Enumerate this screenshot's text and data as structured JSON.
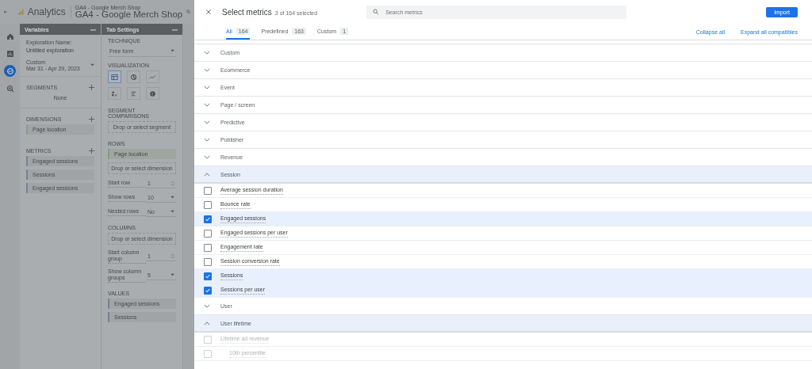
{
  "app": {
    "product": "Analytics",
    "property_caption": "GA4 - Google Merch Shop",
    "property": "GA4 - Google Merch Shop"
  },
  "rail": [
    {
      "kind": "home",
      "selected": false
    },
    {
      "kind": "reports",
      "selected": false
    },
    {
      "kind": "explore",
      "selected": true
    },
    {
      "kind": "advertising",
      "selected": false
    }
  ],
  "variables": {
    "title": "Variables",
    "exploration_label": "Exploration Name:",
    "exploration_name": "Untitled exploration",
    "date_label": "Custom",
    "date_range": "Mar 31 - Apr 29, 2023",
    "segments": {
      "title": "SEGMENTS",
      "empty": "None"
    },
    "dimensions": {
      "title": "DIMENSIONS",
      "items": [
        "Page location"
      ]
    },
    "metrics": {
      "title": "METRICS",
      "items": [
        "Engaged sessions",
        "Sessions",
        "Engaged sessions"
      ]
    }
  },
  "tab_settings": {
    "title": "Tab Settings",
    "technique": {
      "label": "TECHNIQUE",
      "value": "Free form"
    },
    "visualization": {
      "label": "VISUALIZATION",
      "options": [
        {
          "kind": "table",
          "selected": true
        },
        {
          "kind": "donut",
          "selected": false
        },
        {
          "kind": "line",
          "selected": false
        },
        {
          "kind": "scatter",
          "selected": false
        },
        {
          "kind": "bar",
          "selected": false
        },
        {
          "kind": "geo",
          "selected": false
        }
      ]
    },
    "segment_comparisons": {
      "label": "SEGMENT COMPARISONS",
      "placeholder": "Drop or select segment"
    },
    "rows": {
      "label": "ROWS",
      "items": [
        "Page location"
      ],
      "placeholder": "Drop or select dimension",
      "settings": [
        {
          "label": "Start row",
          "value": "1",
          "kind": "stepper"
        },
        {
          "label": "Show rows",
          "value": "10",
          "kind": "select"
        },
        {
          "label": "Nested rows",
          "value": "No",
          "kind": "select"
        }
      ]
    },
    "columns": {
      "label": "COLUMNS",
      "placeholder": "Drop or select dimension",
      "settings": [
        {
          "label": "Start column group",
          "value": "1",
          "kind": "stepper"
        },
        {
          "label": "Show column groups",
          "value": "5",
          "kind": "select"
        }
      ]
    },
    "values": {
      "label": "VALUES",
      "items": [
        "Engaged sessions",
        "Sessions"
      ]
    }
  },
  "dialog": {
    "title": "Select metrics",
    "count": "3 of 164 selected",
    "search": {
      "placeholder": "Search metrics"
    },
    "import": "Import",
    "tabs": [
      {
        "label": "All",
        "count": "164",
        "selected": true
      },
      {
        "label": "Predefined",
        "count": "163",
        "selected": false
      },
      {
        "label": "Custom",
        "count": "1",
        "selected": false
      }
    ],
    "actions": [
      "Collapse all",
      "Expand all compatibles"
    ],
    "groups": [
      {
        "name": "Custom",
        "expanded": false
      },
      {
        "name": "Ecommerce",
        "expanded": false
      },
      {
        "name": "Event",
        "expanded": false
      },
      {
        "name": "Page / screen",
        "expanded": false
      },
      {
        "name": "Predictive",
        "expanded": false
      },
      {
        "name": "Publisher",
        "expanded": false
      },
      {
        "name": "Revenue",
        "expanded": false
      },
      {
        "name": "Session",
        "expanded": true,
        "metrics": [
          {
            "name": "Average session duration",
            "checked": false,
            "disabled": false
          },
          {
            "name": "Bounce rate",
            "checked": false,
            "disabled": false
          },
          {
            "name": "Engaged sessions",
            "checked": true,
            "disabled": false
          },
          {
            "name": "Engaged sessions per user",
            "checked": false,
            "disabled": false
          },
          {
            "name": "Engagement rate",
            "checked": false,
            "disabled": false
          },
          {
            "name": "Session conversion rate",
            "checked": false,
            "disabled": false
          },
          {
            "name": "Sessions",
            "checked": true,
            "disabled": false
          },
          {
            "name": "Sessions per user",
            "checked": true,
            "disabled": false
          }
        ]
      },
      {
        "name": "User",
        "expanded": false
      },
      {
        "name": "User lifetime",
        "expanded": true,
        "metrics": [
          {
            "name": "Lifetime ad revenue",
            "checked": false,
            "disabled": true,
            "children": [
              {
                "name": "10th percentile",
                "checked": false,
                "disabled": true
              }
            ]
          }
        ]
      }
    ]
  }
}
